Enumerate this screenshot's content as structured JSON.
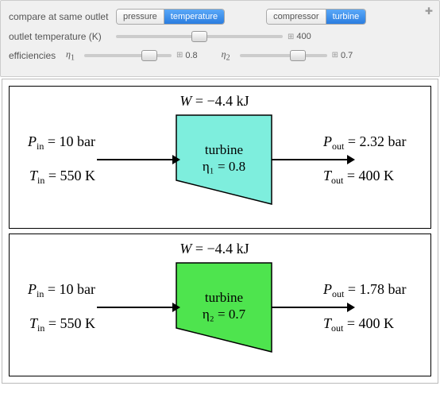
{
  "controls": {
    "compare_label": "compare at same outlet",
    "compare_options": {
      "pressure": "pressure",
      "temperature": "temperature"
    },
    "compare_selected": "temperature",
    "device_options": {
      "compressor": "compressor",
      "turbine": "turbine"
    },
    "device_selected": "turbine",
    "outlet_temp_label": "outlet temperature (K)",
    "outlet_temp_value": "400",
    "efficiencies_label": "efficiencies",
    "eta1_label": "η",
    "eta1_sub": "1",
    "eta1_value": "0.8",
    "eta2_label": "η",
    "eta2_sub": "2",
    "eta2_value": "0.7"
  },
  "chart_data": [
    {
      "type": "diagram",
      "title": "W = −4.4 kJ",
      "device": "turbine",
      "eta_label": "η₁ = 0.8",
      "fill": "#7EEEDD",
      "P_in": "10 bar",
      "T_in": "550 K",
      "P_out": "2.32 bar",
      "T_out": "400 K"
    },
    {
      "type": "diagram",
      "title": "W = −4.4 kJ",
      "device": "turbine",
      "eta_label": "η₂ = 0.7",
      "fill": "#4EE44E",
      "P_in": "10 bar",
      "T_in": "550 K",
      "P_out": "1.78 bar",
      "T_out": "400 K"
    }
  ],
  "labels": {
    "P_in": "P",
    "P_in_sub": "in",
    "T_in": "T",
    "T_in_sub": "in",
    "P_out": "P",
    "P_out_sub": "out",
    "T_out": "T",
    "T_out_sub": "out",
    "W": "W"
  }
}
